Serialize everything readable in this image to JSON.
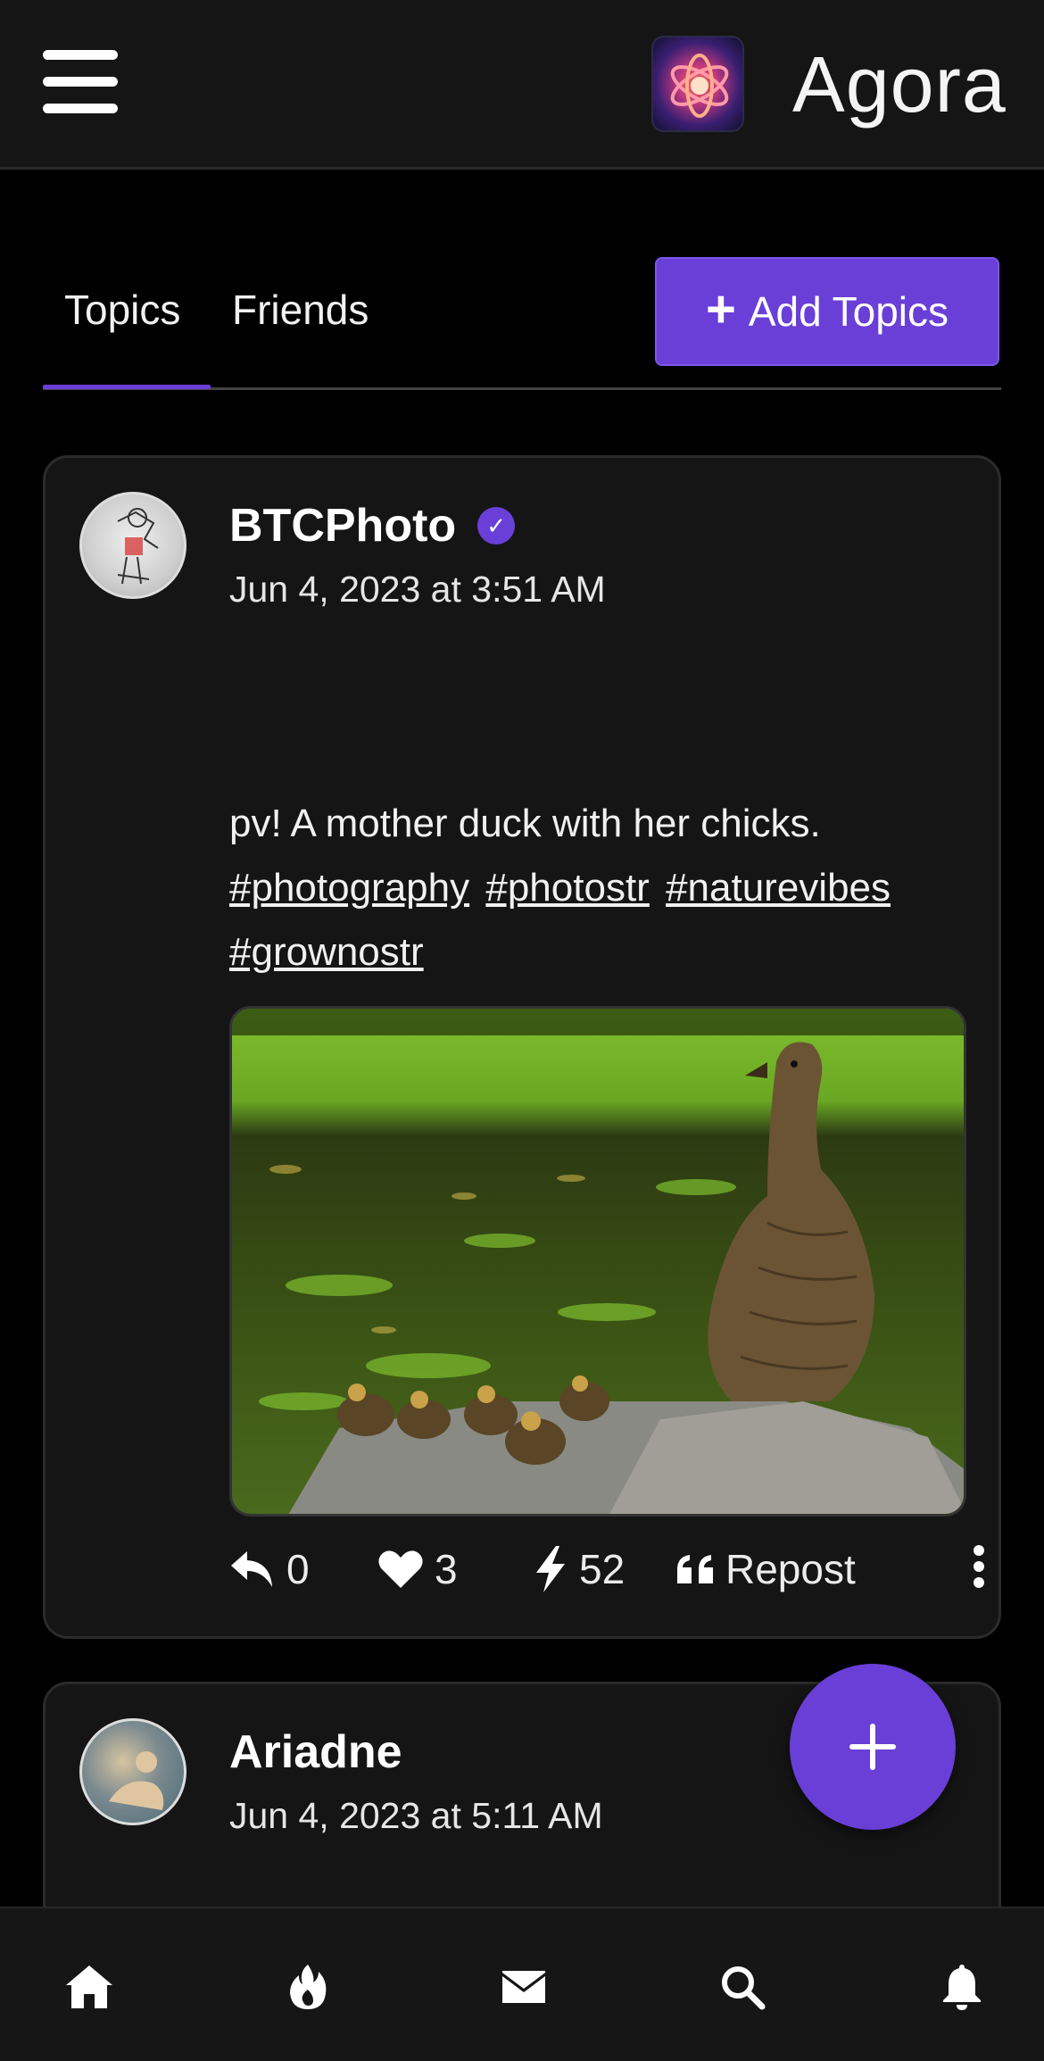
{
  "header": {
    "title": "Agora",
    "menu_icon": "hamburger-icon",
    "logo_icon": "agora-logo-icon"
  },
  "tabs": {
    "items": [
      {
        "label": "Topics",
        "active": true
      },
      {
        "label": "Friends",
        "active": false
      }
    ],
    "add_button_label": "Add Topics"
  },
  "posts": [
    {
      "author": "BTCPhoto",
      "verified": true,
      "date": "Jun 4, 2023 at 3:51 AM",
      "text": "pv! A mother duck with her chicks.",
      "hashtags": [
        "#photography",
        "#photostr",
        "#naturevibes",
        "#grownostr"
      ],
      "image_description_icon": "duck-photo-image",
      "replies": "0",
      "likes": "3",
      "zaps": "52",
      "repost_label": "Repost"
    },
    {
      "author": "Ariadne",
      "date": "Jun 4, 2023 at 5:11 AM"
    }
  ],
  "fab": {
    "icon": "plus-icon"
  },
  "bottom_nav": [
    "home-icon",
    "fire-icon",
    "mail-icon",
    "search-icon",
    "bell-icon"
  ],
  "colors": {
    "accent": "#6a3fd8",
    "background": "#000000",
    "card": "#151515"
  }
}
